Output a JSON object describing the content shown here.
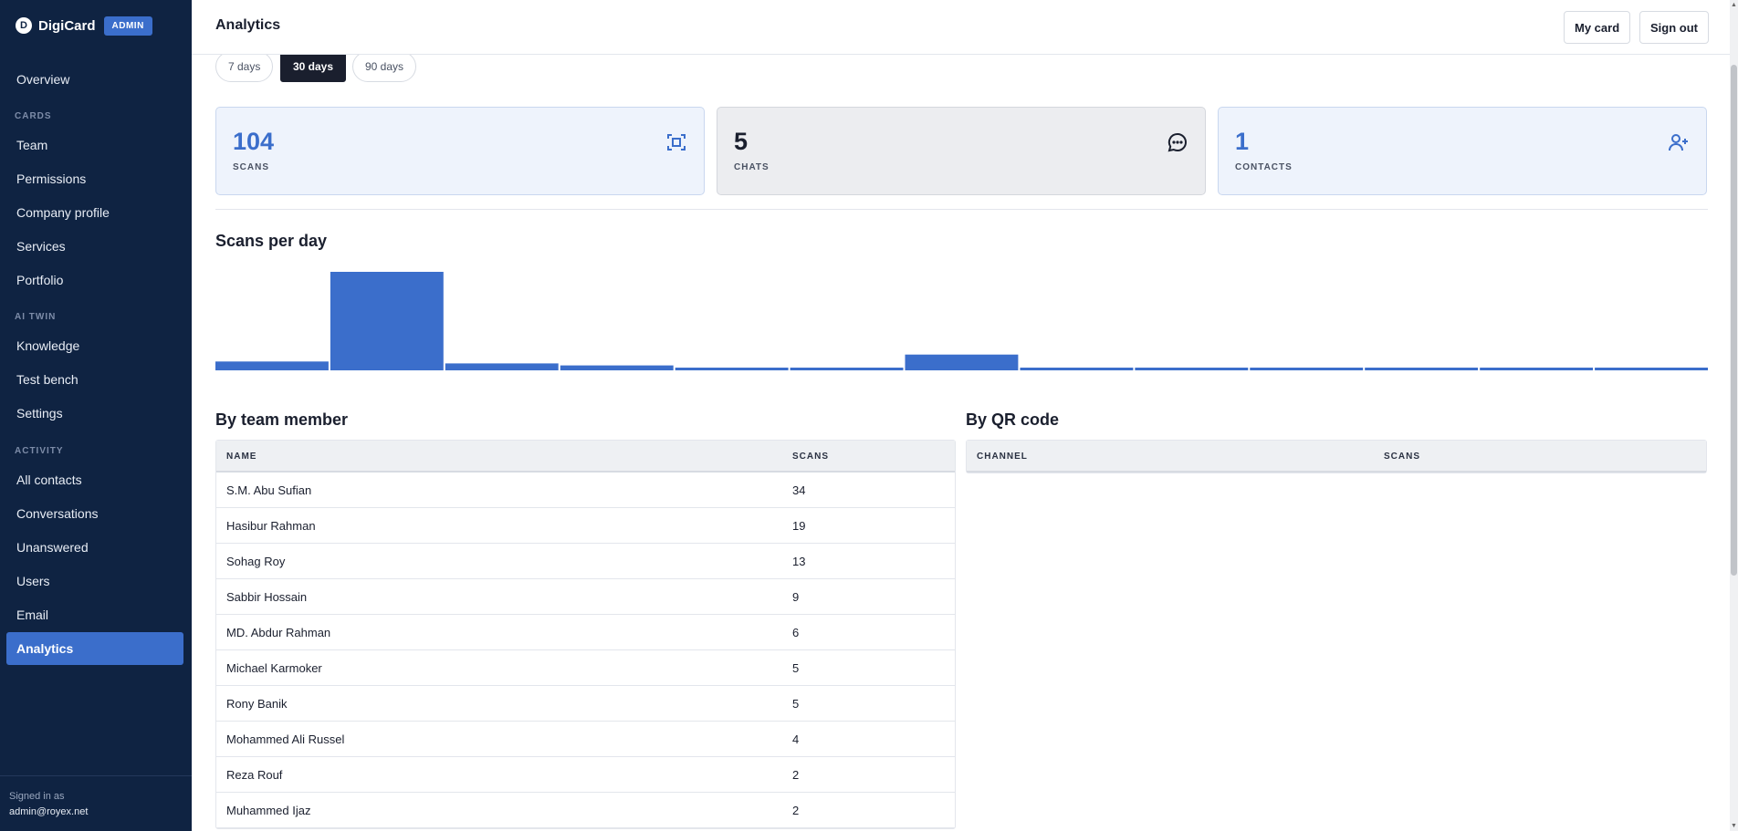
{
  "brand": {
    "logo_letter": "D",
    "name": "DigiCard",
    "badge": "ADMIN"
  },
  "sidebar": {
    "items": [
      {
        "label": "Overview"
      },
      {
        "section": "CARDS"
      },
      {
        "label": "Team"
      },
      {
        "label": "Permissions"
      },
      {
        "label": "Company profile"
      },
      {
        "label": "Services"
      },
      {
        "label": "Portfolio"
      },
      {
        "section": "AI TWIN"
      },
      {
        "label": "Knowledge"
      },
      {
        "label": "Test bench"
      },
      {
        "label": "Settings"
      },
      {
        "section": "ACTIVITY"
      },
      {
        "label": "All contacts"
      },
      {
        "label": "Conversations"
      },
      {
        "label": "Unanswered"
      },
      {
        "label": "Users"
      },
      {
        "label": "Email"
      },
      {
        "label": "Analytics",
        "active": true
      }
    ],
    "signed_in_label": "Signed in as",
    "signed_in_email": "admin@royex.net"
  },
  "header": {
    "title": "Analytics",
    "my_card": "My card",
    "sign_out": "Sign out"
  },
  "ranges": [
    {
      "label": "7 days"
    },
    {
      "label": "30 days",
      "active": true
    },
    {
      "label": "90 days"
    }
  ],
  "stats": [
    {
      "value": "104",
      "label": "SCANS",
      "icon": "scan-icon"
    },
    {
      "value": "5",
      "label": "CHATS",
      "icon": "chat-icon"
    },
    {
      "value": "1",
      "label": "CONTACTS",
      "icon": "add-user-icon"
    }
  ],
  "colors": {
    "accent": "#3b6ecb",
    "sidebar": "#0f2342"
  },
  "chart_title": "Scans per day",
  "chart_data": {
    "type": "bar",
    "title": "Scans per day",
    "values": [
      9,
      100,
      7,
      5,
      2,
      2,
      16,
      2,
      2,
      2,
      2,
      2,
      2
    ],
    "ylim": [
      0,
      100
    ]
  },
  "team_table": {
    "title": "By team member",
    "columns": [
      "NAME",
      "SCANS"
    ],
    "rows": [
      [
        "S.M. Abu Sufian",
        "34"
      ],
      [
        "Hasibur Rahman",
        "19"
      ],
      [
        "Sohag Roy",
        "13"
      ],
      [
        "Sabbir Hossain",
        "9"
      ],
      [
        "MD. Abdur Rahman",
        "6"
      ],
      [
        "Michael Karmoker",
        "5"
      ],
      [
        "Rony Banik",
        "5"
      ],
      [
        "Mohammed Ali Russel",
        "4"
      ],
      [
        "Reza Rouf",
        "2"
      ],
      [
        "Muhammed Ijaz",
        "2"
      ]
    ]
  },
  "qr_table": {
    "title": "By QR code",
    "columns": [
      "CHANNEL",
      "SCANS"
    ]
  }
}
